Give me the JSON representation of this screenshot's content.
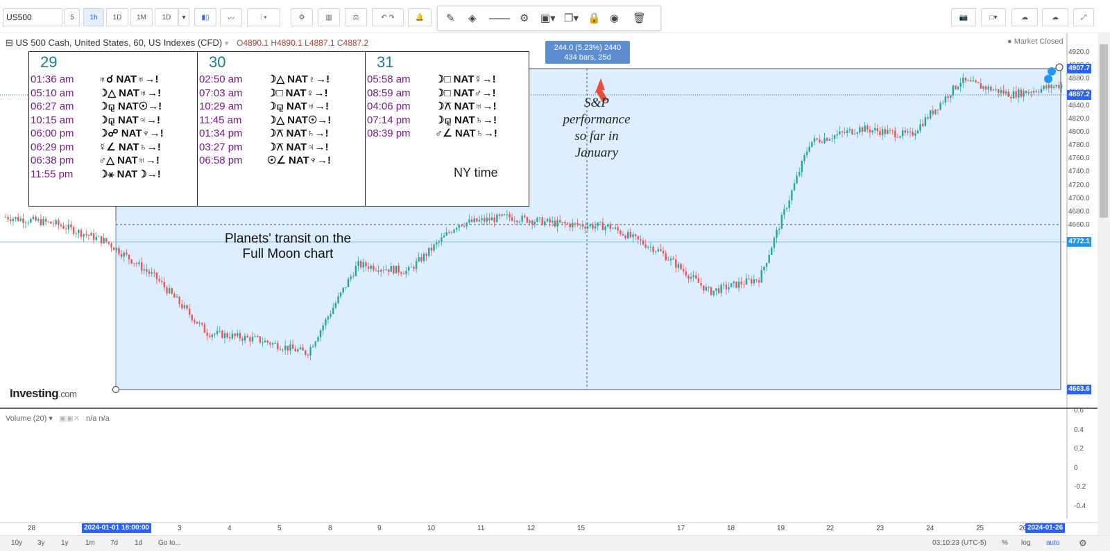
{
  "toolbar": {
    "symbol": "US500",
    "intervals": [
      "5",
      "1h",
      "1D",
      "1M",
      "1D"
    ],
    "active_interval": "1h"
  },
  "legend": {
    "title": "US 500 Cash, United States, 60, US Indexes (CFD)",
    "o_label": "O",
    "o": "4890.1",
    "h_label": "H",
    "h": "4890.1",
    "l_label": "L",
    "l": "4887.1",
    "c_label": "C",
    "c": "4887.2",
    "market_status": "Market Closed"
  },
  "astro_table": {
    "days": [
      {
        "day": "29",
        "rows": [
          {
            "time": "01:36 am",
            "aspect": "♅☌ NAT♅→!"
          },
          {
            "time": "05:10 am",
            "aspect": "☽△ NAT♅→!"
          },
          {
            "time": "06:27 am",
            "aspect": "☽⚼ NAT☉→!"
          },
          {
            "time": "10:15 am",
            "aspect": "☽⚼ NAT♃→!"
          },
          {
            "time": "06:00 pm",
            "aspect": "☽☍ NAT♆→!"
          },
          {
            "time": "06:29 pm",
            "aspect": "☿∠ NAT♄→!"
          },
          {
            "time": "06:38 pm",
            "aspect": "♂△ NAT♅→!"
          },
          {
            "time": "11:55 pm",
            "aspect": "☽⚹ NAT☽→!"
          }
        ]
      },
      {
        "day": "30",
        "rows": [
          {
            "time": "02:50 am",
            "aspect": "☽△ NAT♇→!"
          },
          {
            "time": "07:03 am",
            "aspect": "☽□ NAT♀→!"
          },
          {
            "time": "10:29 am",
            "aspect": "☽⚼ NAT♅→!"
          },
          {
            "time": "11:45 am",
            "aspect": "☽△ NAT☉→!"
          },
          {
            "time": "01:34 pm",
            "aspect": "☽⚻ NAT♄→!"
          },
          {
            "time": "03:27 pm",
            "aspect": "☽⚻ NAT♃→!"
          },
          {
            "time": "06:58 pm",
            "aspect": "☉∠ NAT♆→!"
          }
        ]
      },
      {
        "day": "31",
        "rows": [
          {
            "time": "05:58 am",
            "aspect": "☽□ NAT☿→!"
          },
          {
            "time": "08:59 am",
            "aspect": "☽□ NAT♂→!"
          },
          {
            "time": "04:06 pm",
            "aspect": "☽⚻ NAT♅→!"
          },
          {
            "time": "07:14 pm",
            "aspect": "☽⚼ NAT♄→!"
          },
          {
            "time": "08:39 pm",
            "aspect": "♂∠ NAT♄→!"
          }
        ]
      }
    ],
    "note": "NY time"
  },
  "measure": {
    "line1": "244.0 (5.23%) 2440",
    "line2": "434 bars, 25d"
  },
  "annotations": {
    "sp_text": [
      "S&P",
      "performance",
      "so far in",
      "January"
    ],
    "planets_text": [
      "Planets' transit on the",
      "Full Moon chart"
    ]
  },
  "logo": {
    "main": "Investing",
    "suffix": ".com"
  },
  "price_axis": {
    "ticks": [
      "4920.0",
      "4900.0",
      "4880.0",
      "4860.0",
      "4840.0",
      "4820.0",
      "4800.0",
      "4780.0",
      "4760.0",
      "4740.0",
      "4720.0",
      "4700.0",
      "4680.0",
      "4660.0"
    ],
    "tags": [
      {
        "label": "4907.7",
        "color": "#2962ff"
      },
      {
        "label": "4887.2",
        "color": "#2962ff"
      },
      {
        "label": "4772.1",
        "color": "#2196f3"
      },
      {
        "label": "4663.6",
        "color": "#2962ff"
      }
    ]
  },
  "volume": {
    "title": "Volume (20)",
    "values": [
      "n/a",
      "n/a"
    ],
    "ticks": [
      "0.6",
      "0.4",
      "0.2",
      "0",
      "-0.2",
      "-0.4"
    ]
  },
  "time_axis": {
    "labels": [
      "28",
      "3",
      "4",
      "5",
      "8",
      "9",
      "10",
      "11",
      "12",
      "15",
      "17",
      "18",
      "19",
      "22",
      "23",
      "24",
      "25",
      "26"
    ],
    "tag_start": "2024-01-01 18:00:00",
    "tag_end": "2024-01-26"
  },
  "bottom_bar": {
    "ranges": [
      "10y",
      "3y",
      "1y",
      "1m",
      "7d",
      "1d"
    ],
    "goto": "Go to...",
    "clock": "03:10:23 (UTC-5)",
    "percent": "%",
    "log": "log",
    "auto": "auto"
  },
  "colors": {
    "up": "#26a69a",
    "down": "#ef5350",
    "range_fill": "#ddeeff",
    "accent": "#2962ff"
  },
  "chart_data": {
    "type": "candlestick",
    "title": "US 500 Cash, United States, 60, US Indexes (CFD)",
    "xlabel": "",
    "ylabel": "",
    "ylim": [
      4650,
      4925
    ],
    "measure_range": {
      "start": 4663.6,
      "end": 4907.7,
      "change": 244.0,
      "change_pct": 5.23,
      "bars": 434,
      "days": 25
    },
    "series": [
      {
        "x": [
          "Dec 28",
          "Dec 29",
          "Jan 1",
          "Jan 2",
          "Jan 3",
          "Jan 4",
          "Jan 5",
          "Jan 8",
          "Jan 9",
          "Jan 10",
          "Jan 11",
          "Jan 12",
          "Jan 15",
          "Jan 16",
          "Jan 17",
          "Jan 18",
          "Jan 19",
          "Jan 22",
          "Jan 23",
          "Jan 24",
          "Jan 25",
          "Jan 26"
        ],
        "values": [
          4790,
          4785,
          4772,
          4745,
          4705,
          4700,
          4690,
          4755,
          4750,
          4785,
          4790,
          4785,
          4783,
          4765,
          4735,
          4745,
          4845,
          4855,
          4850,
          4890,
          4880,
          4887
        ]
      }
    ]
  }
}
